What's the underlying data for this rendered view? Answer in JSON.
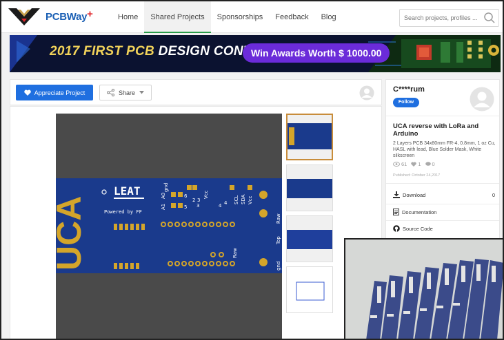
{
  "header": {
    "logo_text": "PCBWay",
    "logo_plus": "+",
    "nav": [
      {
        "label": "Home",
        "active": false
      },
      {
        "label": "Shared Projects",
        "active": true
      },
      {
        "label": "Sponsorships",
        "active": false
      },
      {
        "label": "Feedback",
        "active": false
      },
      {
        "label": "Blog",
        "active": false
      }
    ],
    "search_placeholder": "Search projects, profiles ..."
  },
  "banner": {
    "title_gold": "2017 FIRST PCB ",
    "title_white": "DESIGN CONTEST",
    "pill": "Win Awards Worth $ 1000.00",
    "colors": {
      "bg": "#0b1230",
      "pill": "#6b2bd9",
      "gold": "#f2d35a"
    }
  },
  "actions": {
    "appreciate_label": "Appreciate Project",
    "share_label": "Share"
  },
  "pcb": {
    "board_text": "UCA",
    "brand": "LEAT",
    "powered": "Powered by FF",
    "labels": [
      "gnd",
      "Vcc",
      "Raw",
      "Top",
      "gnd",
      "Raw",
      "SCL",
      "SDA",
      "Vcc",
      "A1",
      "A0",
      "6",
      "5",
      "3",
      "4",
      "4",
      "3",
      "2"
    ]
  },
  "sidebar": {
    "author": "C****rum",
    "follow_label": "Follow",
    "title": "UCA reverse with LoRa and Arduino",
    "description": "2 Layers PCB 34x80mm FR-4, 0.8mm, 1 oz Cu, HASL with lead, Blue Solder Mask, White silkscreen",
    "views": "61",
    "likes": "1",
    "comments": "0",
    "published": "Published: October 24,2017",
    "download_label": "Download",
    "download_count": "0",
    "documentation_label": "Documentation",
    "source_label": "Source Code"
  },
  "icons": {
    "appreciate": "heart-icon",
    "share": "share-icon",
    "search": "search-icon",
    "download": "download-icon",
    "documentation": "document-icon",
    "source": "github-icon"
  },
  "colors": {
    "accent": "#1f6fe0",
    "active_tab": "#2a9d4a",
    "pcb_blue": "#1a3a8c",
    "gold": "#d4a52a"
  }
}
